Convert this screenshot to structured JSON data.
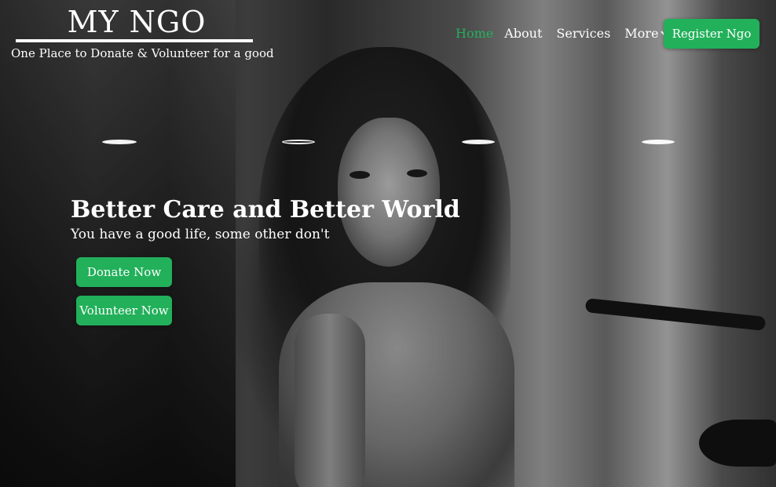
{
  "brand": {
    "title": "MY NGO",
    "tagline": "One Place to Donate & Volunteer for a good"
  },
  "nav": {
    "items": [
      {
        "label": "Home",
        "active": true
      },
      {
        "label": "About",
        "active": false
      },
      {
        "label": "Services",
        "active": false
      },
      {
        "label": "More",
        "active": false,
        "icon": "chevron-down-icon"
      }
    ],
    "register_label": "Register Ngo"
  },
  "carousel": {
    "indicator_count": 4,
    "active_index": 1
  },
  "hero": {
    "headline": "Better Care and Better World",
    "subline": "You have a good life, some other don't",
    "donate_label": "Donate Now",
    "volunteer_label": "Volunteer Now"
  },
  "colors": {
    "accent": "#22b05a",
    "text": "#ffffff"
  }
}
